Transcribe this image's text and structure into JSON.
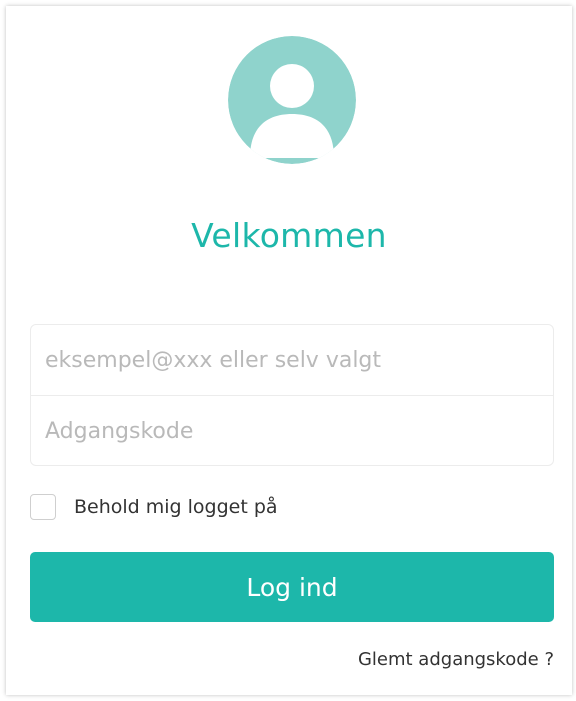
{
  "header": {
    "avatar_icon": "user-avatar-icon",
    "welcome_text": "Velkommen"
  },
  "form": {
    "email_placeholder": "eksempel@xxx eller selv valgt",
    "email_value": "",
    "password_placeholder": "Adgangskode",
    "password_value": "",
    "remember_label": "Behold mig logget på",
    "remember_checked": false,
    "login_label": "Log ind",
    "forgot_label": "Glemt adgangskode ?"
  },
  "colors": {
    "accent": "#1db7aa",
    "avatar_bg": "#8fd3cc",
    "text": "#333333",
    "placeholder": "#b9b9b9"
  }
}
